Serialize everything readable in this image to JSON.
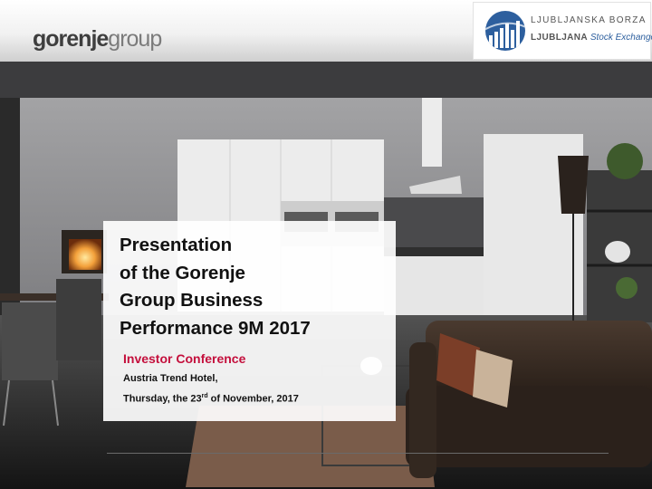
{
  "brand": {
    "logo_main": "gorenje",
    "logo_suffix": "group"
  },
  "exchange": {
    "line1": "LJUBLJANSKA BORZA",
    "line2_bold": "LJUBLJANA",
    "line2_italic": "Stock Exchange"
  },
  "title_lines": [
    "Presentation",
    "of the Gorenje",
    "Group Business",
    "Performance 9M 2017"
  ],
  "subtitle": "Investor Conference",
  "venue": "Austria Trend Hotel,",
  "date": {
    "prefix": "Thursday, the 23",
    "sup": "rd",
    "suffix": " of November, 2017"
  },
  "colors": {
    "accent": "#c40f3c",
    "stock_blue": "#2d5f9e"
  }
}
